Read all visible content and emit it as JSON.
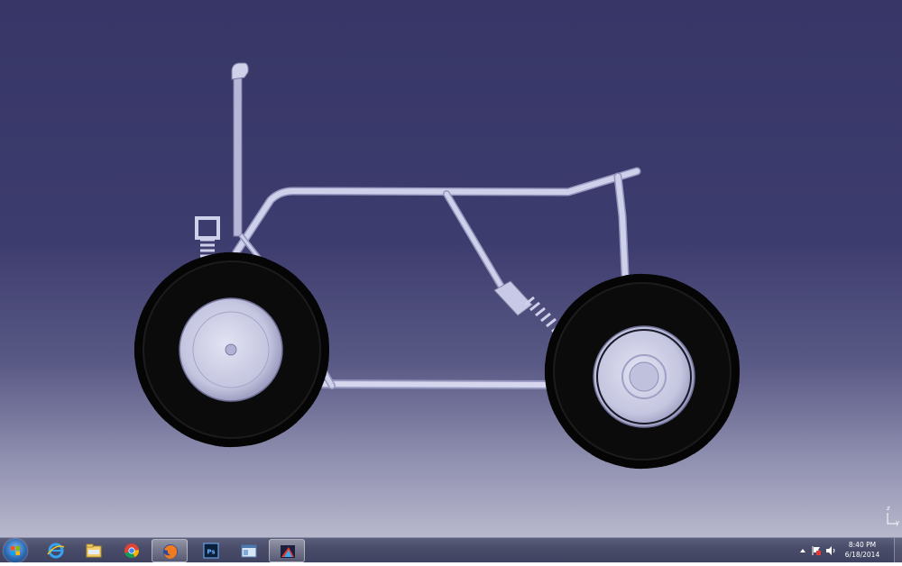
{
  "model": {
    "name": "atv-frame-3d-model",
    "parts": [
      "frame-tube",
      "steering-column",
      "front-wheel",
      "rear-wheel",
      "front-shock",
      "rear-shock"
    ],
    "colors": {
      "background_top": "#373667",
      "background_bottom": "#b8b8cd",
      "frame": "#cfd0ea",
      "tire": "#050505",
      "rim": "#c9cae2"
    }
  },
  "compass": {
    "z_label": "z",
    "y_label": "y"
  },
  "taskbar": {
    "start_icon": "windows-orb-icon",
    "pinned": [
      {
        "name": "ie-icon",
        "active": false
      },
      {
        "name": "folder-icon",
        "active": false
      },
      {
        "name": "chrome-icon",
        "active": false
      },
      {
        "name": "firefox-icon",
        "active": true
      },
      {
        "name": "photoshop-icon",
        "active": false
      },
      {
        "name": "window-icon",
        "active": false
      },
      {
        "name": "catia-icon",
        "active": true
      }
    ],
    "photoshop_label": "Ps",
    "tray": {
      "time": "8:40 PM",
      "date": "6/18/2014",
      "icons": [
        "arrow-up-icon",
        "flag-icon",
        "speaker-icon"
      ]
    }
  }
}
